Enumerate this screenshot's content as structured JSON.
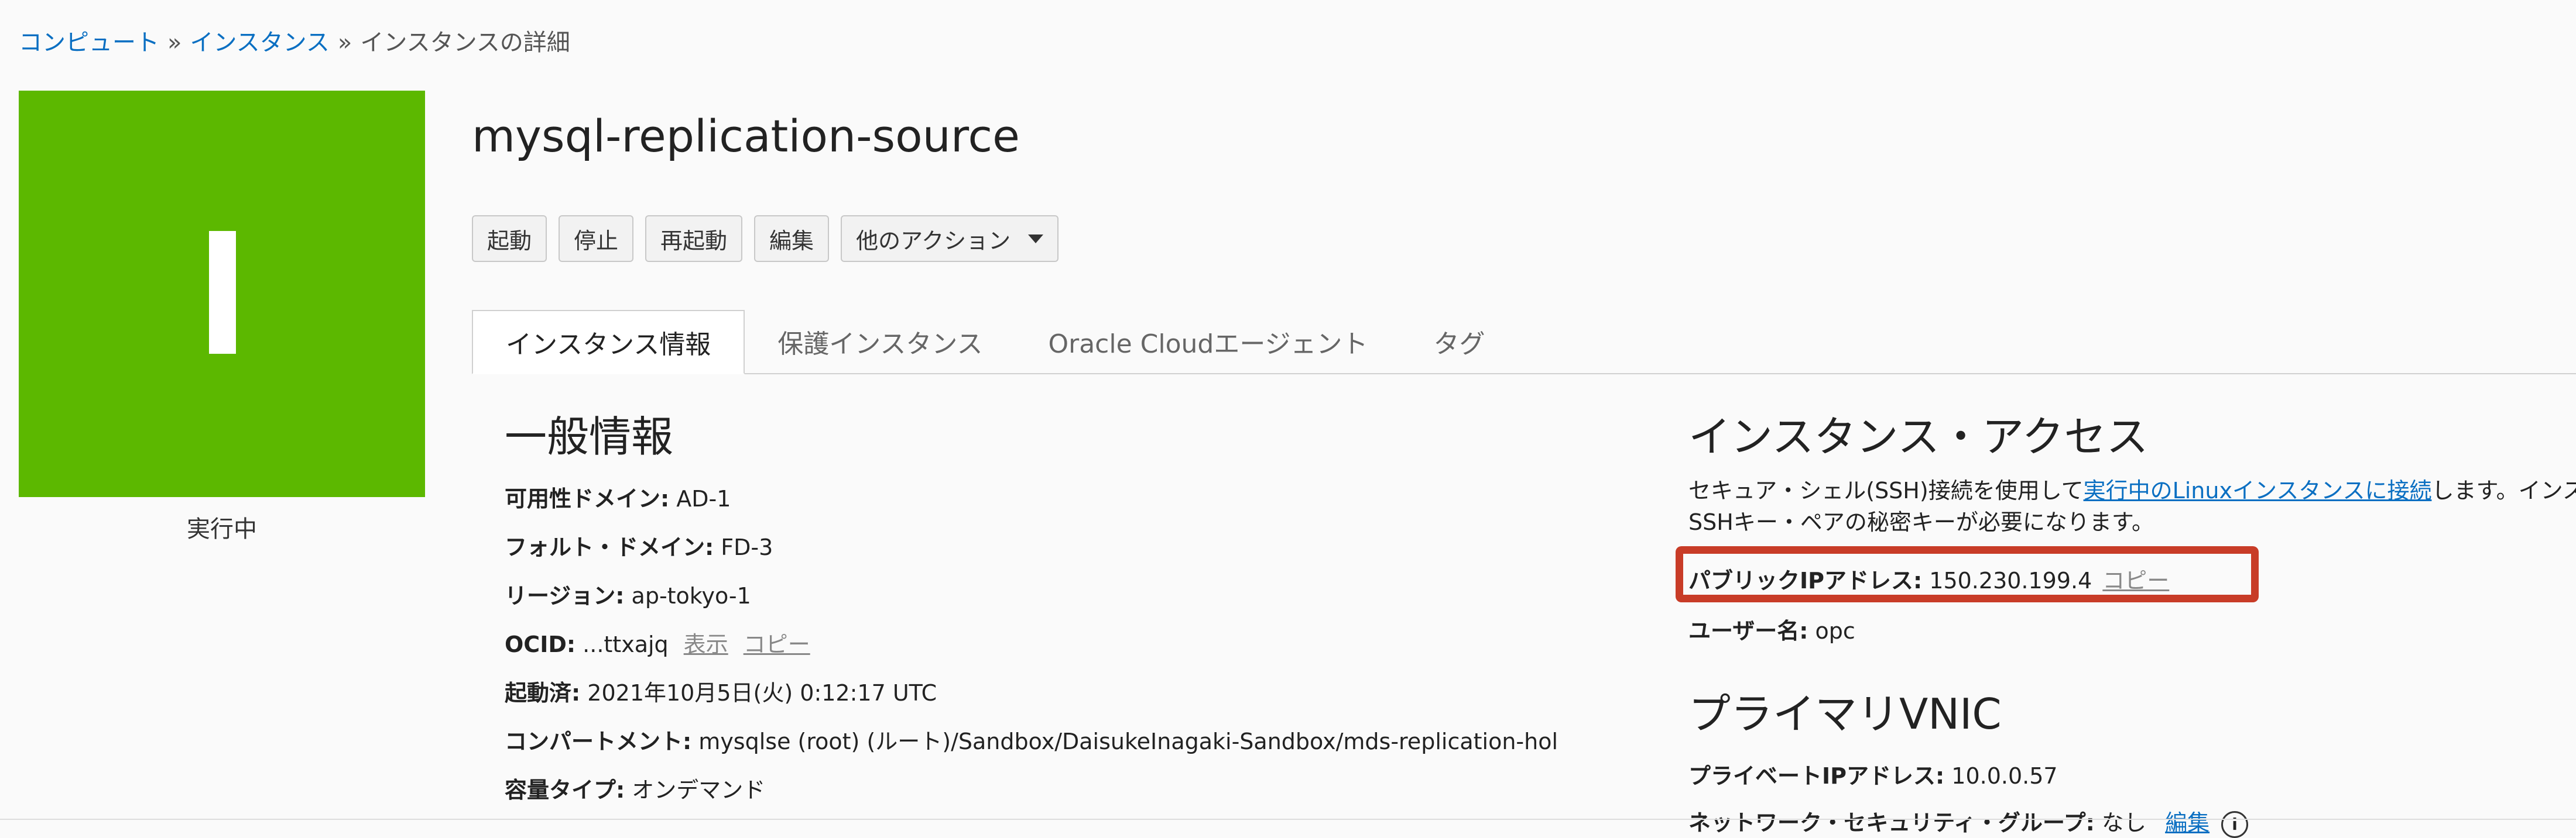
{
  "breadcrumb": {
    "compute": "コンピュート",
    "instances": "インスタンス",
    "current": "インスタンスの詳細",
    "sep": "»"
  },
  "instance": {
    "icon_letter": "I",
    "state": "実行中",
    "name": "mysql-replication-source",
    "tile_color": "#5cb800"
  },
  "actions": {
    "start": "起動",
    "stop": "停止",
    "reboot": "再起動",
    "edit": "編集",
    "more": "他のアクション"
  },
  "tabs": [
    "インスタンス情報",
    "保護インスタンス",
    "Oracle Cloudエージェント",
    "タグ"
  ],
  "general": {
    "heading": "一般情報",
    "ad_label": "可用性ドメイン:",
    "ad_value": "AD-1",
    "fd_label": "フォルト・ドメイン:",
    "fd_value": "FD-3",
    "region_label": "リージョン:",
    "region_value": "ap-tokyo-1",
    "ocid_label": "OCID:",
    "ocid_value": "...ttxajq",
    "ocid_show": "表示",
    "ocid_copy": "コピー",
    "launched_label": "起動済:",
    "launched_value": "2021年10月5日(火) 0:12:17 UTC",
    "compartment_label": "コンパートメント:",
    "compartment_value": "mysqlse (root) (ルート)/Sandbox/DaisukeInagaki-Sandbox/mds-replication-hol",
    "capacity_label": "容量タイプ:",
    "capacity_value": "オンデマンド"
  },
  "access": {
    "heading": "インスタンス・アクセス",
    "desc_pre": "セキュア・シェル(SSH)接続を使用して",
    "desc_link": "実行中のLinuxインスタンスに接続",
    "desc_post": "します。インス",
    "desc_line2": "SSHキー・ペアの秘密キーが必要になります。",
    "public_ip_label": "パブリックIPアドレス:",
    "public_ip_value": "150.230.199.4",
    "public_ip_copy": "コピー",
    "username_label": "ユーザー名:",
    "username_value": "opc",
    "highlight_color": "#c83c27"
  },
  "vnic": {
    "heading": "プライマリVNIC",
    "private_ip_label": "プライベートIPアドレス:",
    "private_ip_value": "10.0.0.57",
    "nsg_label": "ネットワーク・セキュリティ・グループ:",
    "nsg_value": "なし",
    "nsg_edit": "編集",
    "info_icon": "i"
  }
}
